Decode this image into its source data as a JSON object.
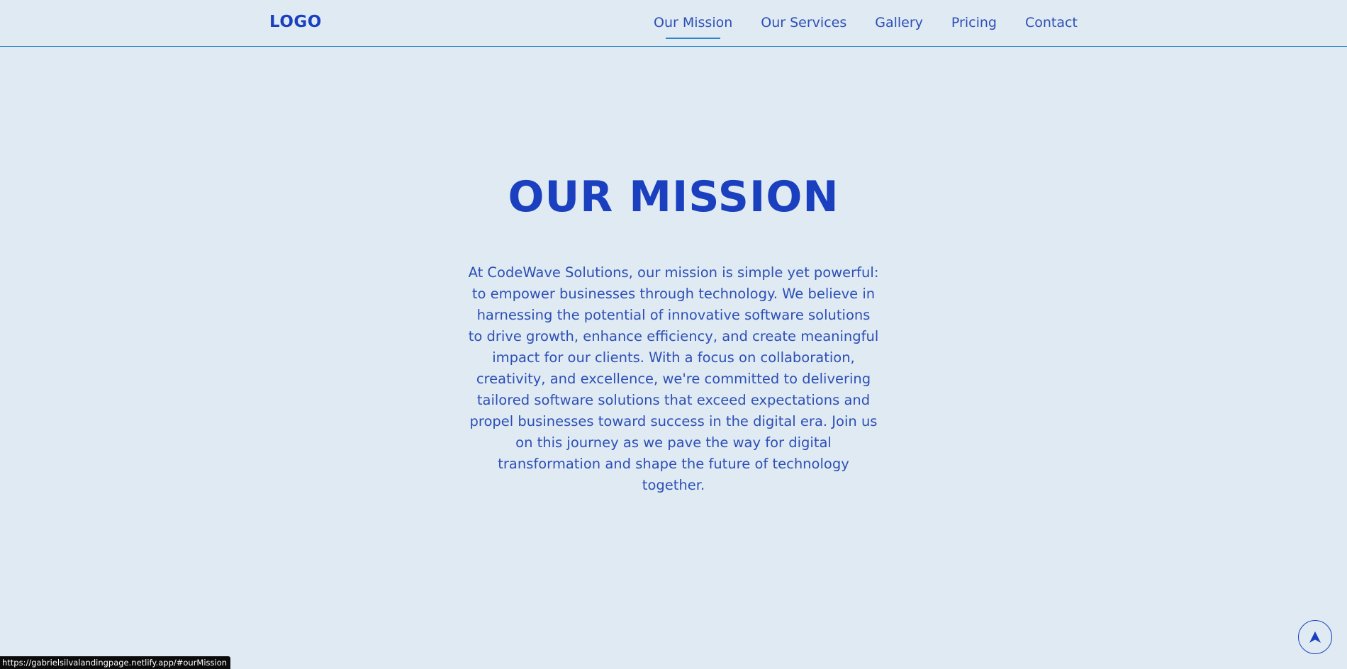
{
  "header": {
    "logo": "LOGO",
    "nav": [
      {
        "label": "Our Mission",
        "active": true
      },
      {
        "label": "Our Services",
        "active": false
      },
      {
        "label": "Gallery",
        "active": false
      },
      {
        "label": "Pricing",
        "active": false
      },
      {
        "label": "Contact",
        "active": false
      }
    ]
  },
  "main": {
    "title": "OUR MISSION",
    "body": "At CodeWave Solutions, our mission is simple yet powerful: to empower businesses through technology. We believe in harnessing the potential of innovative software solutions to drive growth, enhance efficiency, and create meaningful impact for our clients. With a focus on collaboration, creativity, and excellence, we're committed to delivering tailored software solutions that exceed expectations and propel businesses toward success in the digital era. Join us on this journey as we pave the way for digital transformation and shape the future of technology together."
  },
  "scroll_top": {
    "icon": "navigation-arrow-up-icon"
  },
  "status_bar": {
    "url": "https://gabrielsilvalandingpage.netlify.app/#ourMission"
  },
  "colors": {
    "background": "#dfeaf3",
    "accent": "#1a3fbf",
    "text": "#2d4fb6",
    "underline": "#2d86c9"
  }
}
